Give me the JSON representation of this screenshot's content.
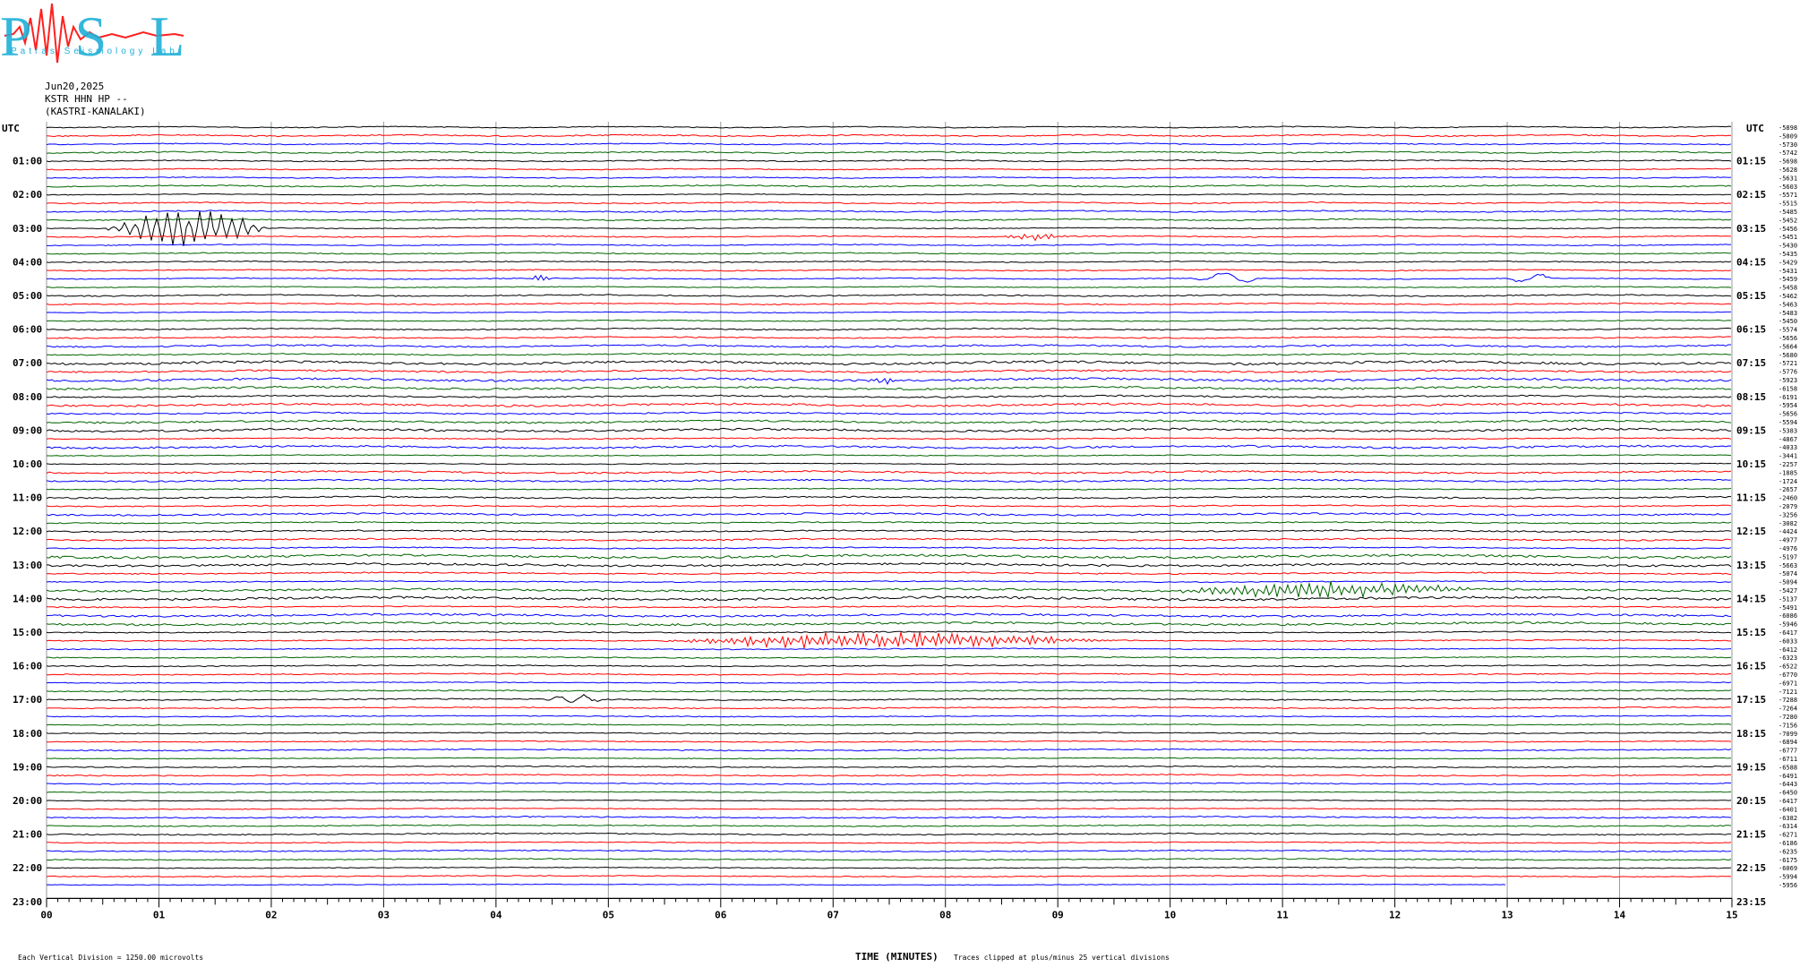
{
  "header": {
    "date": "Jun20,2025",
    "station": "KSTR HHN HP --",
    "location": "(KASTRI-KANALAKI)",
    "utc_left": "UTC",
    "utc_right": "UTC"
  },
  "logo": {
    "letters": "PSL",
    "text": "Patras Seismology Lab",
    "colors": {
      "letters": "#1fb0d8",
      "trace": "#ff2020"
    }
  },
  "footer": {
    "vertical_division": "Each Vertical Division = 1250.00 microvolts",
    "time_label": "TIME (MINUTES)",
    "clip_note": "Traces clipped at plus/minus 25 vertical divisions"
  },
  "chart_data": {
    "type": "line",
    "trace_colors": [
      "#000000",
      "#ff0000",
      "#0000ff",
      "#006400"
    ],
    "x_ticks": [
      "00",
      "01",
      "02",
      "03",
      "04",
      "05",
      "06",
      "07",
      "08",
      "09",
      "10",
      "11",
      "12",
      "13",
      "14",
      "15"
    ],
    "x_range": [
      0,
      15
    ],
    "last_row_end_minute": 13,
    "left_hours": [
      "01:00",
      "02:00",
      "03:00",
      "04:00",
      "05:00",
      "06:00",
      "07:00",
      "08:00",
      "09:00",
      "10:00",
      "11:00",
      "12:00",
      "13:00",
      "14:00",
      "15:00",
      "16:00",
      "17:00",
      "18:00",
      "19:00",
      "20:00",
      "21:00",
      "22:00",
      "23:00"
    ],
    "right_hours": [
      "01:15",
      "02:15",
      "03:15",
      "04:15",
      "05:15",
      "06:15",
      "07:15",
      "08:15",
      "09:15",
      "10:15",
      "11:15",
      "12:15",
      "13:15",
      "14:15",
      "15:15",
      "16:15",
      "17:15",
      "18:15",
      "19:15",
      "20:15",
      "21:15",
      "22:15",
      "23:15"
    ],
    "row_values": [
      "-5898",
      "-5809",
      "-5730",
      "-5742",
      "-5698",
      "-5628",
      "-5631",
      "-5603",
      "-5571",
      "-5515",
      "-5485",
      "-5452",
      "-5456",
      "-5451",
      "-5430",
      "-5435",
      "-5429",
      "-5431",
      "-5459",
      "-5458",
      "-5462",
      "-5463",
      "-5483",
      "-5450",
      "-5574",
      "-5656",
      "-5664",
      "-5680",
      "-5721",
      "-5776",
      "-5923",
      "-6158",
      "-6191",
      "-5954",
      "-5656",
      "-5594",
      "-5383",
      "-4867",
      "-4033",
      "-3441",
      "-2257",
      "-1885",
      "-1724",
      "-2657",
      "-2460",
      "-2079",
      "-3256",
      "-3082",
      "-4424",
      "-4977",
      "-4976",
      "-5197",
      "-5663",
      "-5074",
      "-5094",
      "-5427",
      "-5137",
      "-5491",
      "-6086",
      "-5946",
      "-6417",
      "-6033",
      "-6412",
      "-6323",
      "-6522",
      "-6770",
      "-6971",
      "-7121",
      "-7288",
      "-7264",
      "-7280",
      "-7156",
      "-7099",
      "-6894",
      "-6777",
      "-6711",
      "-6588",
      "-6491",
      "-6443",
      "-6450",
      "-6417",
      "-6401",
      "-6382",
      "-6314",
      "-6271",
      "-6186",
      "-6235",
      "-6175",
      "-6069",
      "-5994",
      "-5956"
    ]
  }
}
